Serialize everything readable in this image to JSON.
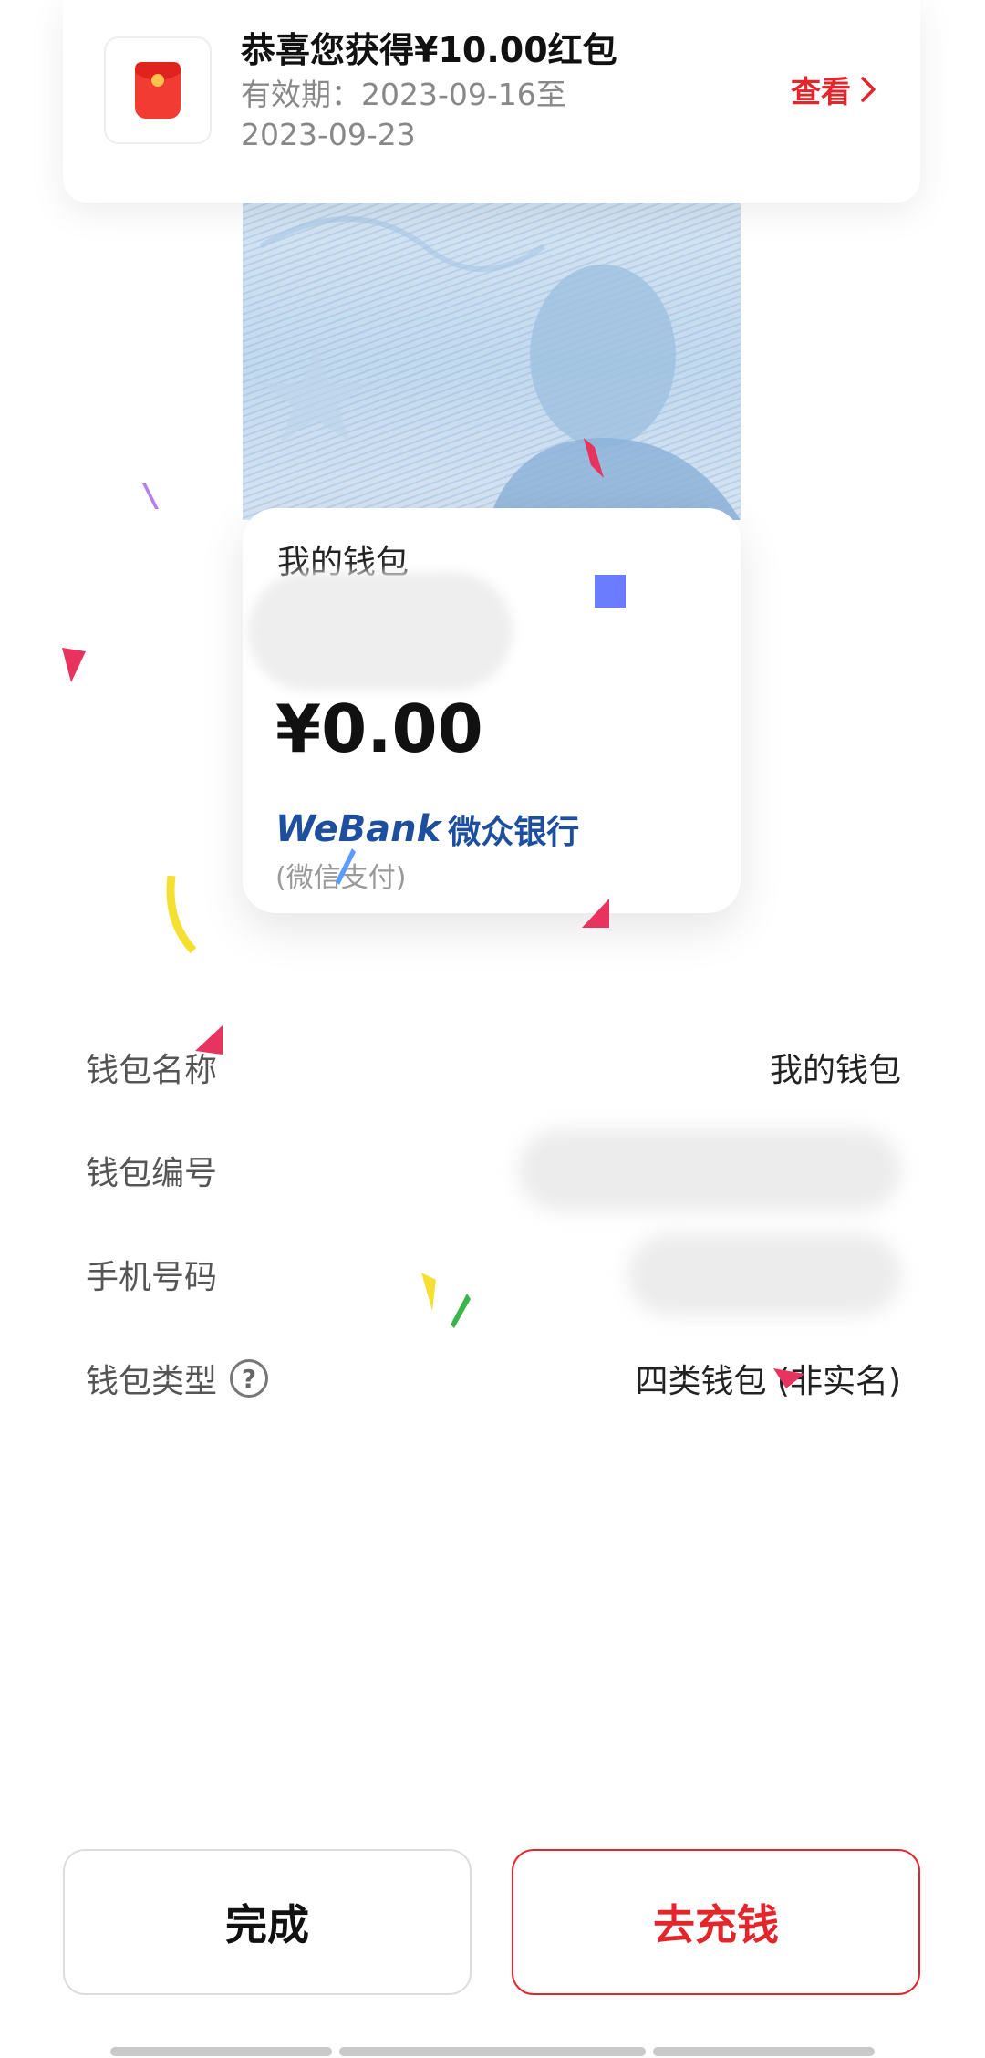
{
  "notice": {
    "title": "恭喜您获得¥10.00红包",
    "validity": "有效期：2023-09-16至2023-09-23",
    "view_label": "查看"
  },
  "card": {
    "wallet_name": "我的钱包",
    "amount": "¥0.00",
    "bank_en": "WeBank",
    "bank_cn": "微众银行",
    "bank_sub": "(微信支付)"
  },
  "info": {
    "rows": [
      {
        "label": "钱包名称",
        "value": "我的钱包"
      },
      {
        "label": "钱包编号",
        "value": ""
      },
      {
        "label": "手机号码",
        "value": ""
      },
      {
        "label": "钱包类型",
        "value": "四类钱包 (非实名)"
      }
    ],
    "help_symbol": "?"
  },
  "buttons": {
    "done": "完成",
    "topup": "去充钱"
  },
  "colors": {
    "accent": "#e2262c",
    "bank_blue": "#1d4f9e"
  },
  "icons": [
    "red-packet-icon",
    "chevron-right-icon",
    "help-circle-icon"
  ]
}
